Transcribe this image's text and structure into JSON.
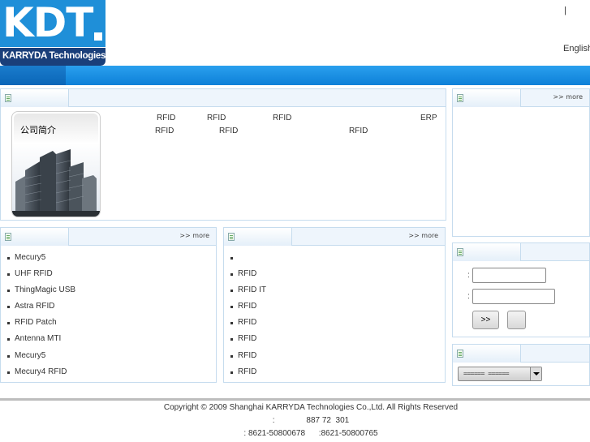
{
  "header": {
    "logo_text": "KDT",
    "logo_subtitle": "KARRYDA Technologies",
    "separator": "|",
    "language_link": "English"
  },
  "company": {
    "more": "",
    "image_title": "公司简介",
    "text_row1": [
      "RFID",
      "RFID",
      "RFID",
      "ERP"
    ],
    "text_row2": [
      "RFID",
      "RFID",
      "RFID"
    ]
  },
  "news": {
    "more": ">> more"
  },
  "products": {
    "more": ">> more",
    "items": [
      "Mecury5",
      "UHF RFID",
      "ThingMagic USB",
      "Astra   RFID",
      "RFID   Patch",
      "Antenna MTI",
      "Mecury5",
      "Mecury4 RFID"
    ]
  },
  "solutions": {
    "more": ">> more",
    "items": [
      "",
      "RFID",
      "RFID     IT",
      "RFID",
      "RFID",
      "RFID",
      "RFID",
      "RFID"
    ]
  },
  "login": {
    "label1": ":",
    "label2": ":",
    "submit": ">>",
    "reset": ""
  },
  "links": {
    "selected": "======  ======"
  },
  "footer": {
    "copyright": "Copyright © 2009 Shanghai KARRYDA Technologies Co.,Ltd. All Rights Reserved",
    "address": ":              887 72  301",
    "phone": ": 8621-50800678      :8621-50800765"
  }
}
